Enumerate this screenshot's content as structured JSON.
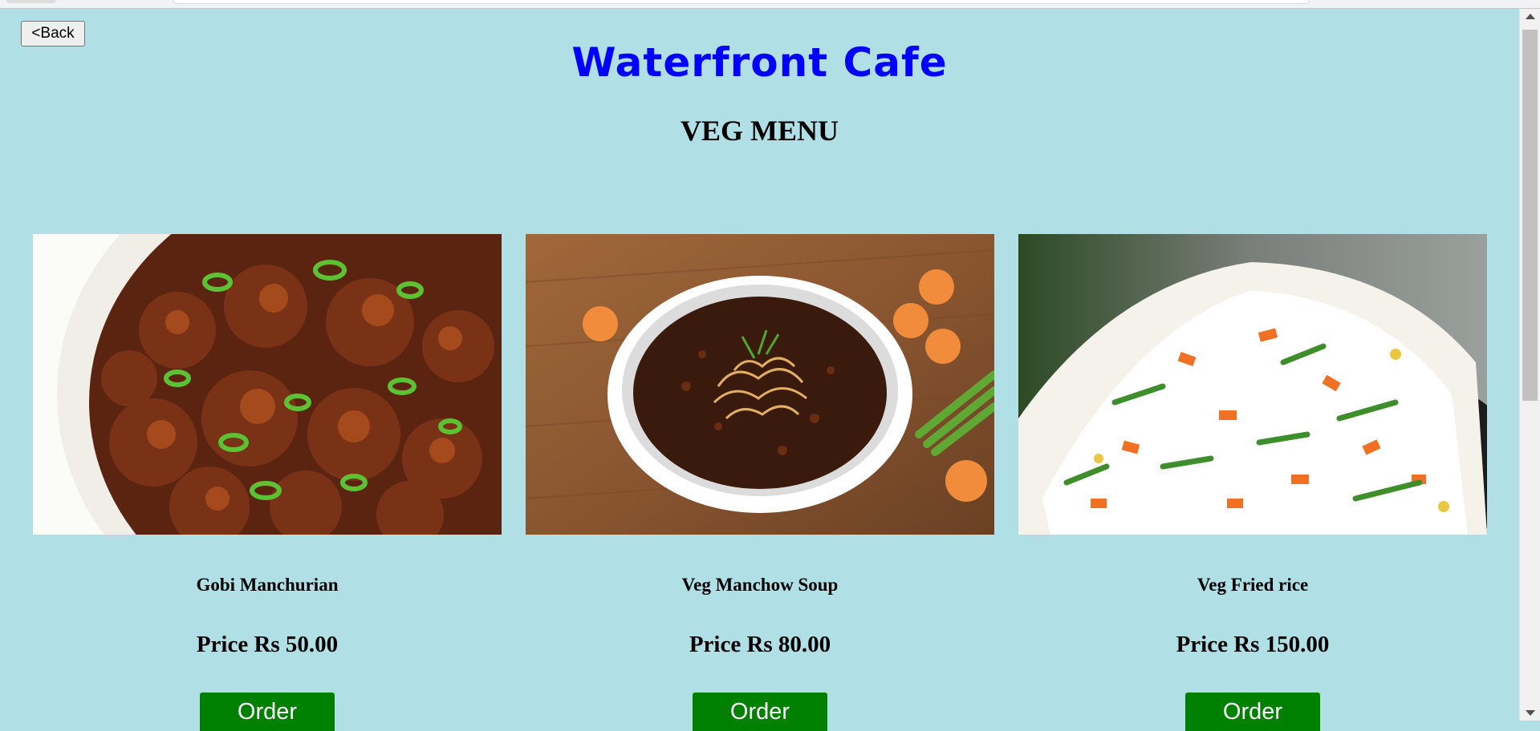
{
  "nav": {
    "back_label": "<Back"
  },
  "header": {
    "site_title": "Waterfront Cafe",
    "menu_title": "VEG MENU"
  },
  "items": [
    {
      "name": "Gobi Manchurian",
      "price": "Price Rs 50.00",
      "order_label": "Order",
      "image": "gobi-manchurian-photo"
    },
    {
      "name": "Veg Manchow Soup",
      "price": "Price Rs 80.00",
      "order_label": "Order",
      "image": "veg-manchow-soup-photo"
    },
    {
      "name": "Veg Fried rice",
      "price": "Price Rs 150.00",
      "order_label": "Order",
      "image": "veg-fried-rice-photo"
    }
  ],
  "colors": {
    "background": "#b0dfe5",
    "title": "#0000ff",
    "order_button": "#008000"
  }
}
